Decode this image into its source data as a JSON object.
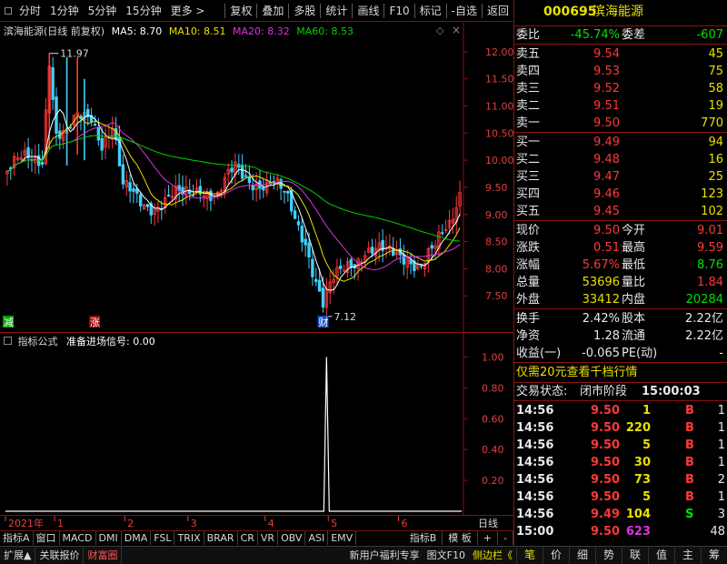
{
  "toolbar": {
    "left": [
      "分时",
      "1分钟",
      "5分钟",
      "15分钟",
      "更多 >"
    ],
    "right": [
      "复权",
      "叠加",
      "多股",
      "统计",
      "画线",
      "F10",
      "标记",
      "-自选",
      "返回"
    ]
  },
  "chart_header": {
    "title": "滨海能源(日线 前复权)",
    "ma5": "MA5: 8.70",
    "ma10": "MA10: 8.51",
    "ma20": "MA20: 8.32",
    "ma60": "MA60: 8.53",
    "colors": {
      "ma5": "#ffffff",
      "ma10": "#e8e000",
      "ma20": "#e030e0",
      "ma60": "#00d000"
    }
  },
  "indicator_header": {
    "name": "指标公式",
    "signal": "准备进场信号: 0.00"
  },
  "price_labels": {
    "high": "11.97",
    "low": "7.12",
    "tag_left": "减",
    "tag_mid": "涨",
    "tag_low": "财"
  },
  "chart_data": [
    {
      "type": "candlestick",
      "title": "滨海能源(日线 前复权)",
      "ylim": [
        7.0,
        12.3
      ],
      "yticks": [
        "12.00",
        "11.50",
        "11.00",
        "10.50",
        "10.00",
        "9.50",
        "9.00",
        "8.50",
        "8.00",
        "7.50"
      ],
      "x_months": [
        "2021年",
        "1",
        "2",
        "3",
        "4",
        "5",
        "6"
      ],
      "n_days": 130,
      "ohlc_anchor": [
        {
          "i": 0,
          "c": 9.8
        },
        {
          "i": 5,
          "c": 9.95
        },
        {
          "i": 10,
          "c": 10.1
        },
        {
          "i": 12,
          "c": 11.97
        },
        {
          "i": 14,
          "c": 10.5
        },
        {
          "i": 17,
          "c": 10.4
        },
        {
          "i": 20,
          "c": 10.7
        },
        {
          "i": 24,
          "c": 10.9
        },
        {
          "i": 27,
          "c": 10.4
        },
        {
          "i": 30,
          "c": 10.6
        },
        {
          "i": 33,
          "c": 9.4
        },
        {
          "i": 38,
          "c": 9.3
        },
        {
          "i": 44,
          "c": 9.2
        },
        {
          "i": 50,
          "c": 9.3
        },
        {
          "i": 55,
          "c": 9.6
        },
        {
          "i": 60,
          "c": 9.3
        },
        {
          "i": 65,
          "c": 9.8
        },
        {
          "i": 70,
          "c": 9.7
        },
        {
          "i": 76,
          "c": 9.5
        },
        {
          "i": 80,
          "c": 9.2
        },
        {
          "i": 85,
          "c": 8.6
        },
        {
          "i": 88,
          "c": 7.8
        },
        {
          "i": 90,
          "c": 7.3
        },
        {
          "i": 93,
          "c": 7.7
        },
        {
          "i": 97,
          "c": 8.1
        },
        {
          "i": 102,
          "c": 8.4
        },
        {
          "i": 108,
          "c": 8.2
        },
        {
          "i": 114,
          "c": 8.3
        },
        {
          "i": 118,
          "c": 8.1
        },
        {
          "i": 122,
          "c": 8.3
        },
        {
          "i": 126,
          "c": 8.8
        },
        {
          "i": 129,
          "c": 9.5
        }
      ]
    },
    {
      "type": "line",
      "title": "指标公式",
      "ylim": [
        0,
        1.05
      ],
      "yticks": [
        "1.00",
        "0.80",
        "0.60",
        "0.40",
        "0.20"
      ],
      "signal_day": 91,
      "signal_value": 1.0
    }
  ],
  "quote": {
    "code": "000695",
    "name": "滨海能源",
    "webi_label": "委比",
    "webi": "-45.74%",
    "weicha_label": "委差",
    "weicha": "-607",
    "asks": [
      {
        "label": "卖五",
        "price": "9.54",
        "vol": "45"
      },
      {
        "label": "卖四",
        "price": "9.53",
        "vol": "75"
      },
      {
        "label": "卖三",
        "price": "9.52",
        "vol": "58"
      },
      {
        "label": "卖二",
        "price": "9.51",
        "vol": "19"
      },
      {
        "label": "卖一",
        "price": "9.50",
        "vol": "770"
      }
    ],
    "bids": [
      {
        "label": "买一",
        "price": "9.49",
        "vol": "94"
      },
      {
        "label": "买二",
        "price": "9.48",
        "vol": "16"
      },
      {
        "label": "买三",
        "price": "9.47",
        "vol": "25"
      },
      {
        "label": "买四",
        "price": "9.46",
        "vol": "123"
      },
      {
        "label": "买五",
        "price": "9.45",
        "vol": "102"
      }
    ],
    "stats1": [
      {
        "l1": "现价",
        "v1": "9.50",
        "c1": "red",
        "l2": "今开",
        "v2": "9.01",
        "c2": "red"
      },
      {
        "l1": "涨跌",
        "v1": "0.51",
        "c1": "red",
        "l2": "最高",
        "v2": "9.59",
        "c2": "red"
      },
      {
        "l1": "涨幅",
        "v1": "5.67%",
        "c1": "red",
        "l2": "最低",
        "v2": "8.76",
        "c2": "green"
      },
      {
        "l1": "总量",
        "v1": "53696",
        "c1": "yellow",
        "l2": "量比",
        "v2": "1.84",
        "c2": "red"
      },
      {
        "l1": "外盘",
        "v1": "33412",
        "c1": "yellow",
        "l2": "内盘",
        "v2": "20284",
        "c2": "green"
      }
    ],
    "stats2": [
      {
        "l1": "换手",
        "v1": "2.42%",
        "l2": "股本",
        "v2": "2.22亿"
      },
      {
        "l1": "净资",
        "v1": "1.28",
        "l2": "流通",
        "v2": "2.22亿"
      },
      {
        "l1": "收益(一)",
        "v1": "-0.065",
        "l2": "PE(动)",
        "v2": "-"
      }
    ],
    "promo": "仅需20元查看千档行情",
    "trade_status_label": "交易状态:",
    "trade_status": "闭市阶段",
    "trade_time": "15:00:03",
    "ticks": [
      {
        "t": "14:56",
        "p": "9.50",
        "v": "1",
        "s": "B",
        "n": "1"
      },
      {
        "t": "14:56",
        "p": "9.50",
        "v": "220",
        "s": "B",
        "n": "1"
      },
      {
        "t": "14:56",
        "p": "9.50",
        "v": "5",
        "s": "B",
        "n": "1"
      },
      {
        "t": "14:56",
        "p": "9.50",
        "v": "30",
        "s": "B",
        "n": "1"
      },
      {
        "t": "14:56",
        "p": "9.50",
        "v": "73",
        "s": "B",
        "n": "2"
      },
      {
        "t": "14:56",
        "p": "9.50",
        "v": "5",
        "s": "B",
        "n": "1"
      },
      {
        "t": "14:56",
        "p": "9.49",
        "v": "104",
        "s": "S",
        "n": "3"
      },
      {
        "t": "15:00",
        "p": "9.50",
        "v": "623",
        "s": "",
        "n": "48"
      }
    ]
  },
  "indicator_tabs": [
    "指标A",
    "窗口",
    "MACD",
    "DMI",
    "DMA",
    "FSL",
    "TRIX",
    "BRAR",
    "CR",
    "VR",
    "OBV",
    "ASI",
    "EMV"
  ],
  "indicator_tabs_right": [
    "指标B",
    "模 板",
    "+",
    "-"
  ],
  "period_label": "日线",
  "status": {
    "left": [
      "扩展▲",
      "关联报价",
      "财富圈"
    ],
    "mid": [
      "新用户福利专享",
      "图文F10",
      "侧边栏《"
    ],
    "right": [
      "笔",
      "价",
      "细",
      "势",
      "联",
      "值",
      "主",
      "筹"
    ]
  }
}
